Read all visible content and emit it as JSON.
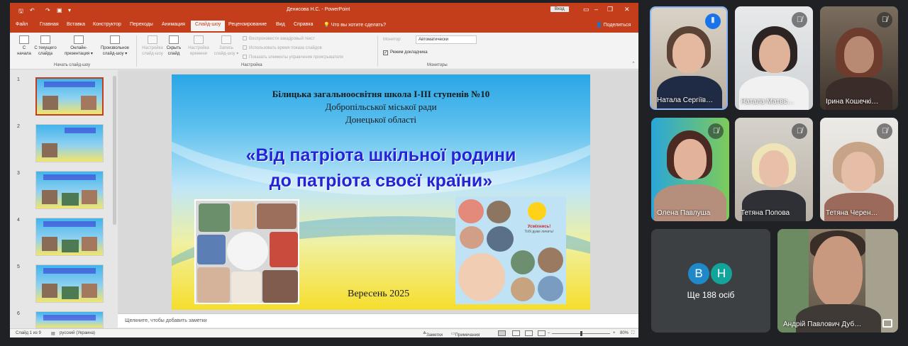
{
  "powerpoint": {
    "title_doc": "Денисова Н.С. - PowerPoint",
    "signin": "Вход",
    "tabs": [
      "Файл",
      "Главная",
      "Вставка",
      "Конструктор",
      "Переходы",
      "Анимация",
      "Слайд-шоу",
      "Рецензирование",
      "Вид",
      "Справка"
    ],
    "active_tab": "Слайд-шоу",
    "tell_me": "Что вы хотите сделать?",
    "share": "Поделиться",
    "ribbon": {
      "btn_from_start_l1": "С",
      "btn_from_start_l2": "начала",
      "btn_from_current_l1": "С текущего",
      "btn_from_current_l2": "слайда",
      "btn_online_l1": "Онлайн-",
      "btn_online_l2": "презентация ▾",
      "btn_custom_l1": "Произвольное",
      "btn_custom_l2": "слайд-шоу ▾",
      "group_start": "Начать слайд-шоу",
      "btn_setup_l1": "Настройка",
      "btn_setup_l2": "слайд-шоу",
      "btn_hide_l1": "Скрыть",
      "btn_hide_l2": "слайд",
      "btn_rehearse_l1": "Настройка",
      "btn_rehearse_l2": "времени",
      "btn_record_l1": "Запись",
      "btn_record_l2": "слайд-шоу ▾",
      "opt_narration": "Воспроизвести закадровый текст",
      "opt_timings": "Использовать время показа слайдов",
      "opt_media": "Показать элементы управления проигрывателя",
      "group_setup": "Настройка",
      "monitor_label": "Монитор:",
      "monitor_value": "Автоматически",
      "presenter_view": "Режим докладчика",
      "group_monitors": "Мониторы"
    },
    "thumb_numbers": [
      "1",
      "2",
      "3",
      "4",
      "5",
      "6"
    ],
    "slide": {
      "school_line1": "Білицька загальноосвітня школа І-ІІІ ступенів №10",
      "school_line2": "Добропільської міської ради",
      "school_line3": "Донецької області",
      "title_line1": "«Від патріота шкільної родини",
      "title_line2": "до патріота своєї країни»",
      "smile_text": "Усміхнись!",
      "smile_sub": "Тобі дуже личить!",
      "date": "Вересень 2025"
    },
    "notes_placeholder": "Щелкните, чтобы добавить заметки",
    "status": {
      "slide_of": "Слайд 1 из 9",
      "language": "русский (Украина)",
      "notes_btn": "Заметки",
      "comments_btn": "Примечания",
      "zoom": "80%"
    }
  },
  "participants": [
    {
      "name": "Натала Сергіїв…",
      "status": "speaking"
    },
    {
      "name": "Натала Матвє…",
      "status": "muted"
    },
    {
      "name": "Ірина Кошечкі…",
      "status": "muted"
    },
    {
      "name": "Олена Павлуша",
      "status": "muted"
    },
    {
      "name": "Тетяна Попова",
      "status": "muted"
    },
    {
      "name": "Тетяна Черен…",
      "status": "muted"
    }
  ],
  "others": {
    "avatar1": "В",
    "avatar2": "Н",
    "avatar1_color": "#1e88c9",
    "avatar2_color": "#12a39a",
    "label": "Ще 188 осіб"
  },
  "featured": {
    "name": "Андрій Павлович Дуб…"
  },
  "colors": {
    "ppt_accent": "#c43e1c",
    "meet_bg": "#202124",
    "speaking": "#1a73e8"
  }
}
